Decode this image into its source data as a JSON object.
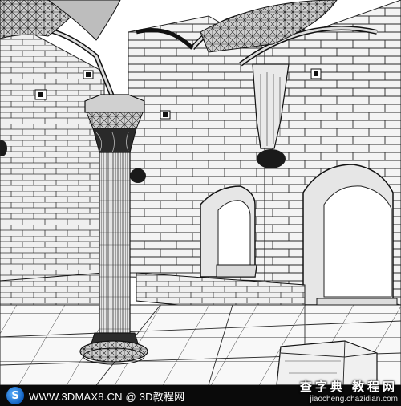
{
  "footer": {
    "logo_glyph": "S",
    "site_text": "WWW.3DMAX8.CN @ 3D教程网"
  },
  "watermark": {
    "title": "查字典 教程网",
    "url": "jiaocheng.chazidian.com"
  },
  "colors": {
    "line": "#202020",
    "wall": "#f2f2f2",
    "floor": "#f7f7f7",
    "footer_bg": "#0a0a0a"
  },
  "icons": {
    "logo": "3dmax8-logo-icon"
  }
}
